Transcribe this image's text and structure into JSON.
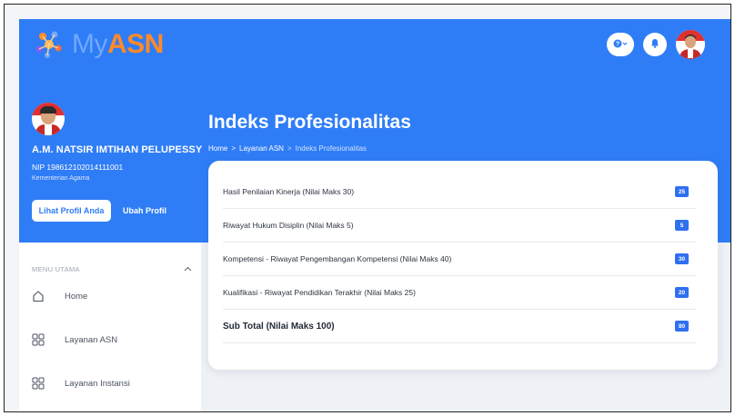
{
  "app": {
    "logo_my": "My",
    "logo_asn": "ASN"
  },
  "topbar": {
    "help_label": "?",
    "notification_label": ""
  },
  "profile": {
    "name": "A.M. NATSIR IMTIHAN PELUPESSY",
    "nip": "NIP 198612102014111001",
    "organization": "Kementerian Agama",
    "view_profile_label": "Lihat Profil Anda",
    "edit_profile_label": "Ubah Profil"
  },
  "sidebar": {
    "menu_header": "MENU UTAMA",
    "items": [
      {
        "label": "Home",
        "icon": "home-icon"
      },
      {
        "label": "Layanan ASN",
        "icon": "grid-icon"
      },
      {
        "label": "Layanan Instansi",
        "icon": "grid-icon"
      }
    ]
  },
  "page": {
    "title": "Indeks Profesionalitas",
    "breadcrumb": [
      "Home",
      ">",
      "Layanan ASN",
      ">",
      "Indeks Profesionalitas"
    ]
  },
  "scores": [
    {
      "label": "Hasil Penilaian Kinerja (Nilai Maks 30)",
      "value": "25"
    },
    {
      "label": "Riwayat Hukum Disiplin (Nilai Maks 5)",
      "value": "5"
    },
    {
      "label": "Kompetensi - Riwayat Pengembangan Kompetensi (Nilai Maks 40)",
      "value": "30"
    },
    {
      "label": "Kualifikasi - Riwayat Pendidikan Terakhir (Nilai Maks 25)",
      "value": "20"
    },
    {
      "label": "Sub Total (Nilai Maks 100)",
      "value": "80"
    }
  ],
  "colors": {
    "brand_blue": "#2f7df6",
    "badge_blue": "#2f6ff0",
    "logo_orange": "#ff8a2a",
    "logo_light_blue": "#6fa8ff"
  }
}
